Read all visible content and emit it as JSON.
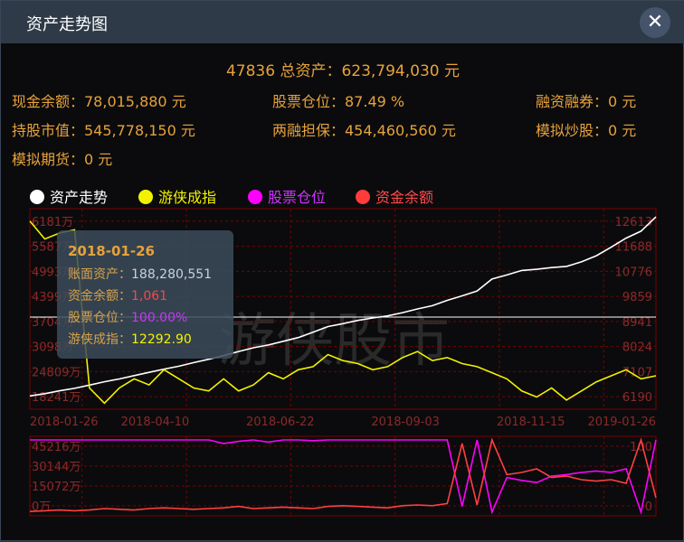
{
  "window": {
    "title": "资产走势图",
    "close_glyph": "✕"
  },
  "summary": {
    "headline": "47836 总资产：623,794,030 元",
    "cash": "现金余额：78,015,880 元",
    "position": "股票仓位：87.49 %",
    "margin": "融资融券：0 元",
    "holding": "持股市值：545,778,150 元",
    "collateral": "两融担保：454,460,560 元",
    "sim_stock": "模拟炒股：0 元",
    "sim_futures": "模拟期货：0 元"
  },
  "legend": [
    {
      "label": "资产走势",
      "color": "#ffffff"
    },
    {
      "label": "游侠成指",
      "color": "#f2f200"
    },
    {
      "label": "股票仓位",
      "color": "#ff00ff"
    },
    {
      "label": "资金余额",
      "color": "#ff3b3b"
    }
  ],
  "watermark": "游侠股市",
  "tooltip": {
    "date": "2018-01-26",
    "rows": [
      {
        "label": "账面资产：",
        "value": "188,280,551",
        "color": "#c9d1da"
      },
      {
        "label": "资金余额：",
        "value": "1,061",
        "color": "#ff4545"
      },
      {
        "label": "股票仓位：",
        "value": "100.00%",
        "color": "#cc33ff"
      },
      {
        "label": "游侠成指：",
        "value": "12292.90",
        "color": "#f2f200"
      }
    ]
  },
  "chart_data": [
    {
      "type": "line",
      "x_ticks": [
        "2018-01-26",
        "2018-04-10",
        "2018-06-22",
        "2018-09-03",
        "2018-11-15",
        "2019-01-26"
      ],
      "left_ticks": [
        "6181万",
        "5587万",
        "4993万",
        "4399万",
        "3704万",
        "3098万",
        "24809万",
        "18241万"
      ],
      "right_ticks": [
        "12613",
        "11688",
        "10776",
        "9859",
        "8941",
        "8024",
        "7107",
        "6190"
      ],
      "grid": true,
      "legend_position": "top-left",
      "series": [
        {
          "name": "资产走势",
          "color": "#ffffff",
          "values": [
            18241,
            18800,
            19500,
            20100,
            20900,
            21700,
            22400,
            23200,
            24000,
            24800,
            25500,
            26400,
            27200,
            28100,
            29100,
            30000,
            30700,
            31600,
            32500,
            33800,
            35200,
            35900,
            36700,
            37300,
            37800,
            38600,
            39500,
            40300,
            41600,
            42700,
            43900,
            46800,
            47800,
            48900,
            49200,
            49600,
            49900,
            51000,
            52500,
            54600,
            56800,
            58500,
            62000
          ]
        },
        {
          "name": "游侠成指",
          "color": "#f2f200",
          "values": [
            12292,
            11700,
            11900,
            12000,
            6800,
            6300,
            6800,
            7100,
            6900,
            7400,
            7100,
            6800,
            6700,
            7100,
            6700,
            6900,
            7300,
            7100,
            7400,
            7500,
            7900,
            7700,
            7600,
            7400,
            7500,
            7800,
            8000,
            7700,
            7800,
            7600,
            7500,
            7300,
            7100,
            6700,
            6500,
            6800,
            6400,
            6700,
            7000,
            7200,
            7400,
            7100,
            7200
          ]
        }
      ]
    },
    {
      "type": "line",
      "left_ticks": [
        "45216万",
        "30144万",
        "15072万",
        "0万"
      ],
      "right_ticks": [
        "100",
        "",
        "",
        "0"
      ],
      "grid": true,
      "series": [
        {
          "name": "股票仓位",
          "color": "#ff00ff",
          "values": [
            100,
            100,
            100,
            100,
            100,
            100,
            100,
            100,
            100,
            100,
            100,
            100,
            100,
            95,
            98,
            100,
            97,
            100,
            100,
            99,
            100,
            100,
            100,
            100,
            100,
            100,
            100,
            100,
            100,
            8,
            100,
            0,
            48,
            44,
            41,
            50,
            52,
            55,
            57,
            55,
            60,
            0,
            100
          ]
        },
        {
          "name": "资金余额",
          "color": "#ff4040",
          "values": [
            1,
            2,
            3,
            2,
            3,
            5,
            4,
            3,
            5,
            6,
            5,
            4,
            5,
            6,
            8,
            5,
            6,
            7,
            6,
            5,
            8,
            9,
            8,
            7,
            6,
            9,
            10,
            9,
            12,
            95,
            10,
            100,
            52,
            55,
            60,
            48,
            50,
            45,
            43,
            45,
            40,
            100,
            20
          ]
        }
      ]
    }
  ]
}
